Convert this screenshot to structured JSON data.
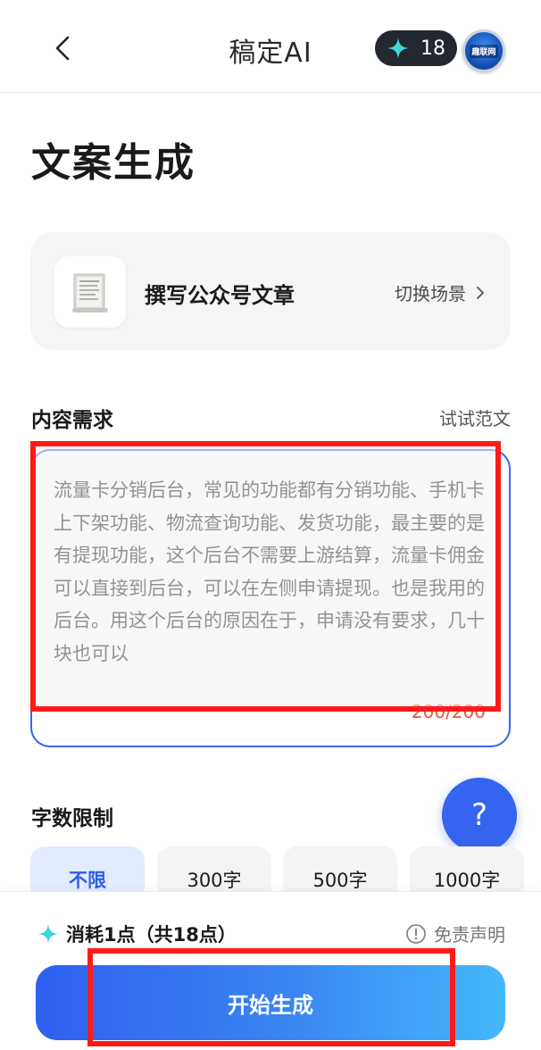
{
  "header": {
    "app_title": "稿定AI",
    "points": "18",
    "avatar_label": "趣联网"
  },
  "page_title": "文案生成",
  "scene": {
    "name": "撰写公众号文章",
    "switch_label": "切换场景",
    "thumb_icon": "document-icon"
  },
  "content_section": {
    "label": "内容需求",
    "sample_link": "试试范文",
    "text": "流量卡分销后台，常见的功能都有分销功能、手机卡上下架功能、物流查询功能、发货功能，最主要的是有提现功能，这个后台不需要上游结算，流量卡佣金可以直接到后台，可以在左侧申请提现。也是我用的后台。用这个后台的原因在于，申请没有要求，几十块也可以",
    "char_count": "200/200"
  },
  "help": {
    "label": "?"
  },
  "word_limit": {
    "label": "字数限制",
    "options": [
      "不限",
      "300字",
      "500字",
      "1000字"
    ],
    "selected": "不限"
  },
  "footer": {
    "cost": "消耗1点（共18点）",
    "disclaimer": "免责声明",
    "generate_label": "开始生成"
  },
  "colors": {
    "accent": "#3464f0",
    "highlight": "#ff1a1a",
    "counter": "#e8553b",
    "pill_bg": "#23272f"
  }
}
